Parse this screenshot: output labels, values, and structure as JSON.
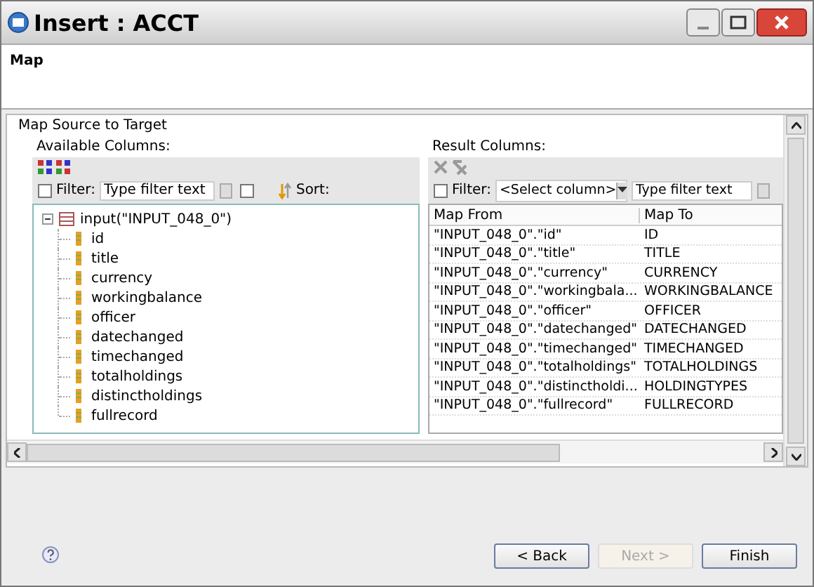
{
  "window": {
    "title": "Insert : ACCT"
  },
  "header": {
    "title": "Map"
  },
  "group": {
    "title": "Map Source to Target"
  },
  "available": {
    "label": "Available Columns:",
    "filter_label": "Filter:",
    "filter_checked": false,
    "filter_placeholder": "Type filter text",
    "option_checked": false,
    "sort_label": "Sort:",
    "tree": {
      "label": "input(\"INPUT_048_0\")",
      "expanded": true,
      "children": [
        {
          "label": "id"
        },
        {
          "label": "title"
        },
        {
          "label": "currency"
        },
        {
          "label": "workingbalance"
        },
        {
          "label": "officer"
        },
        {
          "label": "datechanged"
        },
        {
          "label": "timechanged"
        },
        {
          "label": "totalholdings"
        },
        {
          "label": "distinctholdings"
        },
        {
          "label": "fullrecord"
        }
      ]
    }
  },
  "result": {
    "label": "Result Columns:",
    "filter_label": "Filter:",
    "filter_checked": false,
    "column_select": "<Select column>",
    "filter_placeholder": "Type filter text",
    "columns": [
      "Map From",
      "Map To"
    ],
    "rows": [
      {
        "from": "\"INPUT_048_0\".\"id\"",
        "to": "ID"
      },
      {
        "from": "\"INPUT_048_0\".\"title\"",
        "to": "TITLE"
      },
      {
        "from": "\"INPUT_048_0\".\"currency\"",
        "to": "CURRENCY"
      },
      {
        "from": "\"INPUT_048_0\".\"workingbala...",
        "to": "WORKINGBALANCE"
      },
      {
        "from": "\"INPUT_048_0\".\"officer\"",
        "to": "OFFICER"
      },
      {
        "from": "\"INPUT_048_0\".\"datechanged\"",
        "to": "DATECHANGED"
      },
      {
        "from": "\"INPUT_048_0\".\"timechanged\"",
        "to": "TIMECHANGED"
      },
      {
        "from": "\"INPUT_048_0\".\"totalholdings\"",
        "to": "TOTALHOLDINGS"
      },
      {
        "from": "\"INPUT_048_0\".\"distinctholdi...",
        "to": "HOLDINGTYPES"
      },
      {
        "from": "\"INPUT_048_0\".\"fullrecord\"",
        "to": "FULLRECORD"
      }
    ]
  },
  "buttons": [
    {
      "label": "< Back",
      "disabled": false
    },
    {
      "label": "Next >",
      "disabled": true
    },
    {
      "label": "Finish",
      "disabled": false
    }
  ]
}
